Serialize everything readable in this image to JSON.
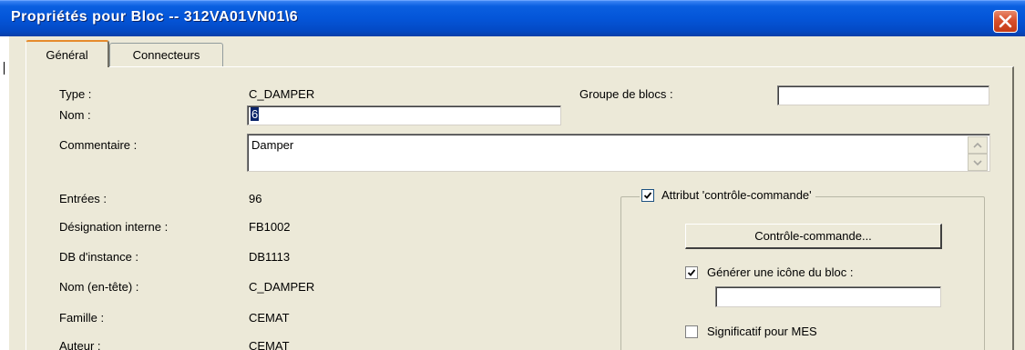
{
  "window": {
    "title": "Propriétés pour Bloc -- 312VA01VN01\\6"
  },
  "tabs": [
    {
      "label": "Général",
      "active": true
    },
    {
      "label": "Connecteurs",
      "active": false
    }
  ],
  "general": {
    "type_label": "Type :",
    "type_value": "C_DAMPER",
    "groupe_label": "Groupe de blocs :",
    "groupe_value": "",
    "nom_label": "Nom :",
    "nom_value": "6",
    "commentaire_label": "Commentaire :",
    "commentaire_value": "Damper",
    "entrees_label": "Entrées :",
    "entrees_value": "96",
    "designation_label": "Désignation interne :",
    "designation_value": "FB1002",
    "db_label": "DB d'instance :",
    "db_value": "DB1113",
    "nom_entete_label": "Nom (en-tête) :",
    "nom_entete_value": "C_DAMPER",
    "famille_label": "Famille :",
    "famille_value": "CEMAT",
    "auteur_label": "Auteur :",
    "auteur_value": "CEMAT"
  },
  "cc_group": {
    "attribut_label": "Attribut 'contrôle-commande'",
    "attribut_checked": true,
    "cc_button_label": "Contrôle-commande...",
    "generer_label": "Générer une icône du bloc :",
    "generer_checked": true,
    "icone_value": "",
    "mes_label": "Significatif pour MES",
    "mes_checked": false
  }
}
